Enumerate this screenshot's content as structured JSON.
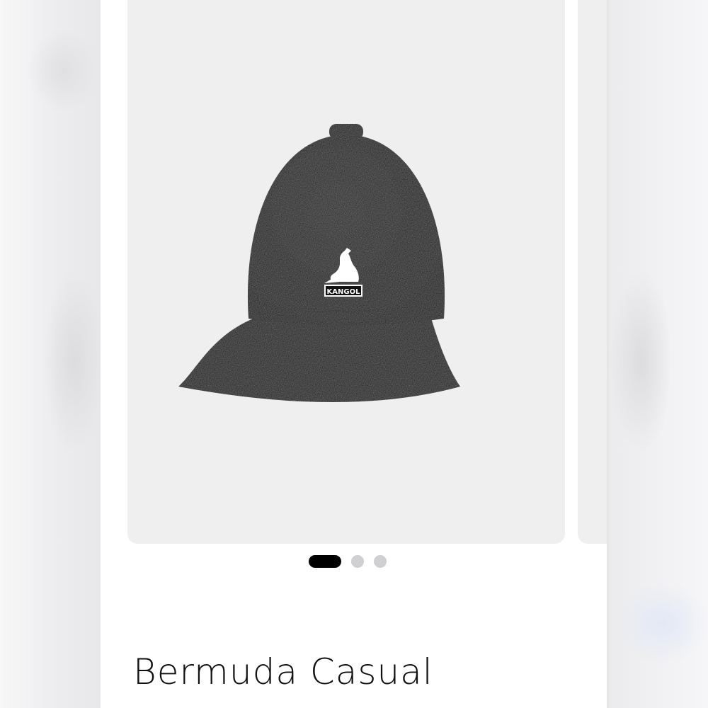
{
  "product": {
    "title": "Bermuda Casual",
    "brand_label": "KANGOL",
    "hat_color": "#161616",
    "image_background": "#efeff0"
  },
  "carousel": {
    "slide_count": 3,
    "active_index": 0,
    "active_dot_color": "#000000",
    "inactive_dot_color": "#d0d0d2"
  },
  "icons": {
    "logo": "kangaroo-icon"
  }
}
